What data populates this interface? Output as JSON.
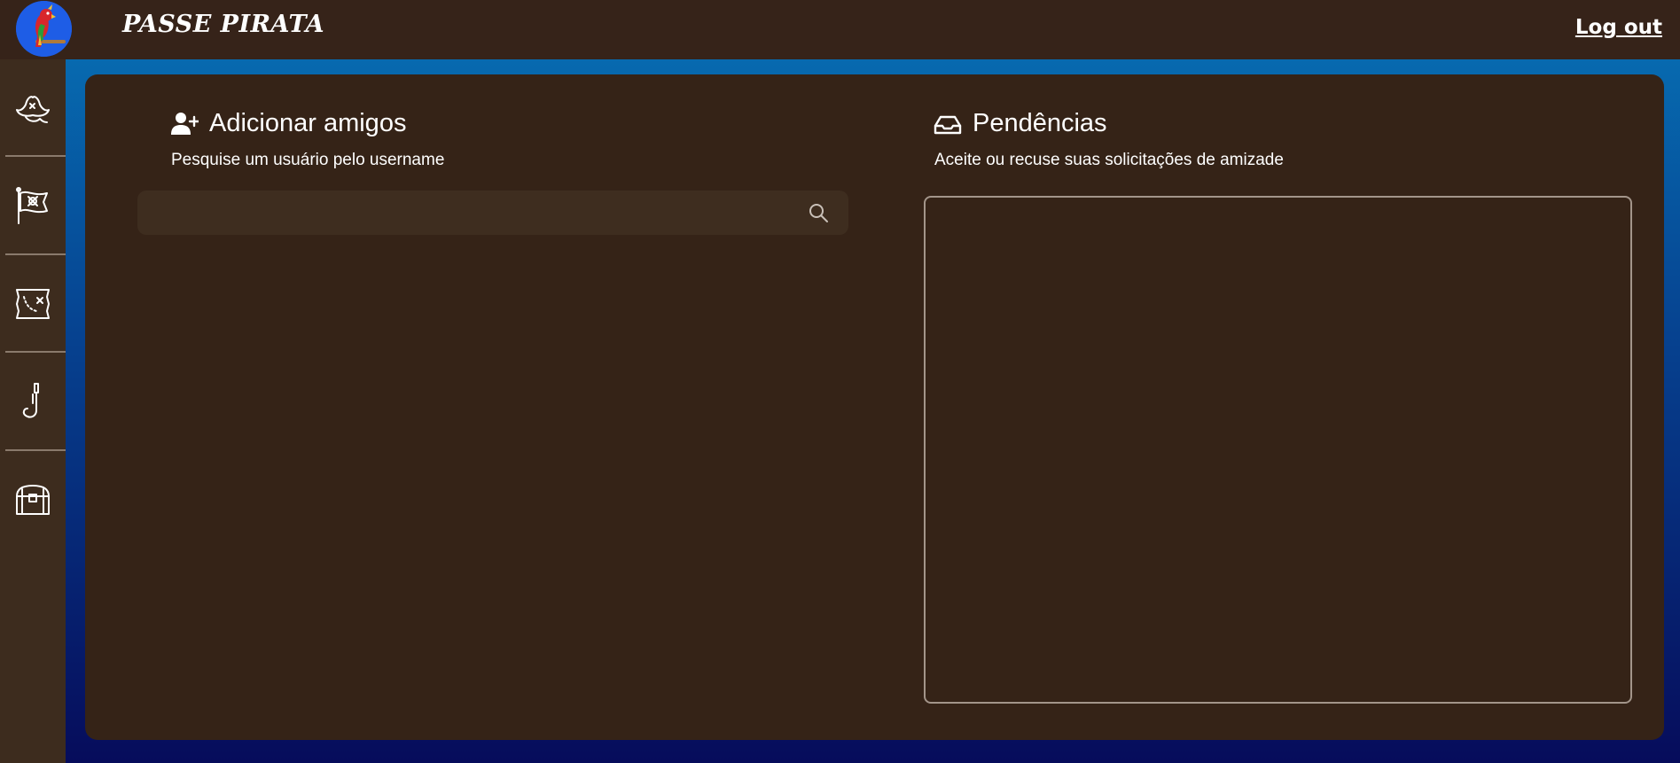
{
  "header": {
    "brand": "PASSE PIRATA",
    "logout_label": "Log out"
  },
  "sidebar": {
    "items": [
      {
        "icon": "pirate-hat-icon"
      },
      {
        "icon": "pirate-flag-icon"
      },
      {
        "icon": "treasure-map-icon"
      },
      {
        "icon": "hook-icon"
      },
      {
        "icon": "treasure-chest-icon"
      }
    ]
  },
  "add_friends": {
    "title": "Adicionar amigos",
    "subtitle": "Pesquise um usuário pelo username",
    "search_value": "",
    "search_placeholder": ""
  },
  "pending": {
    "title": "Pendências",
    "subtitle": "Aceite ou recuse suas solicitações de amizade"
  },
  "colors": {
    "topbar": "#362319",
    "sidebar": "#3d2c1e",
    "panel": "#352317",
    "gradient_top": "#0772b6",
    "gradient_bottom": "#060c5b"
  }
}
